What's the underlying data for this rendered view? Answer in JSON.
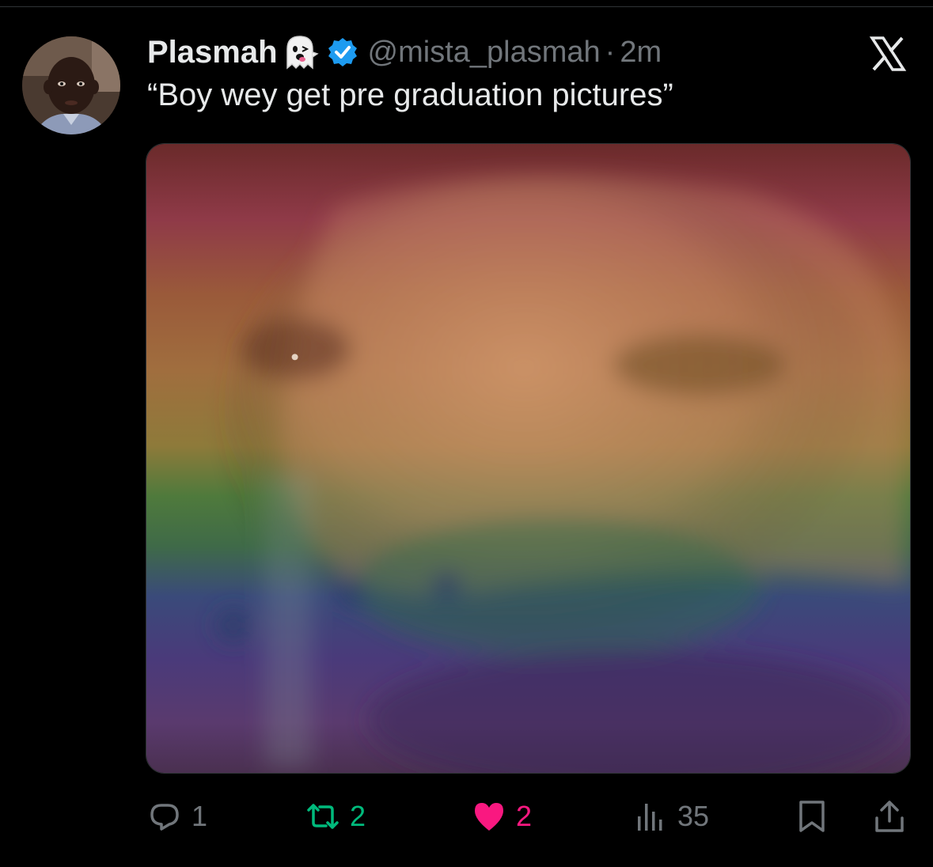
{
  "tweet": {
    "display_name": "Plasmah",
    "name_emoji": "ghost-icon",
    "verified": true,
    "handle": "@mista_plasmah",
    "separator": "·",
    "time": "2m",
    "text": "“Boy wey get pre graduation pictures”",
    "media": {
      "type": "image",
      "description_icon": "photo-image"
    }
  },
  "actions": {
    "reply_count": "1",
    "retweet_count": "2",
    "like_count": "2",
    "view_count": "35"
  },
  "colors": {
    "background": "#000000",
    "text": "#e7e9ea",
    "muted": "#71767b",
    "verified": "#1d9bf0",
    "retweet": "#00ba7c",
    "like": "#f91880"
  },
  "brand": {
    "logo": "x-logo-icon"
  }
}
